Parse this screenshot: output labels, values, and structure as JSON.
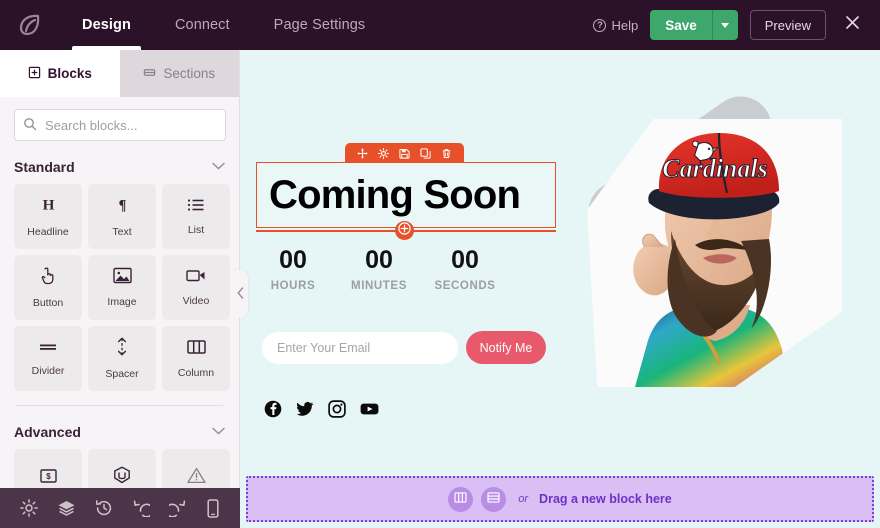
{
  "header": {
    "logo_icon": "leaf-logo-icon",
    "nav": [
      {
        "label": "Design",
        "active": true
      },
      {
        "label": "Connect",
        "active": false
      },
      {
        "label": "Page Settings",
        "active": false
      }
    ],
    "help_label": "Help",
    "save_label": "Save",
    "save_caret_icon": "chevron-down-icon",
    "preview_label": "Preview",
    "close_icon": "close-icon",
    "save_color": "#3da76c",
    "bar_color": "#2c1228"
  },
  "sidebar": {
    "tabs": [
      {
        "label": "Blocks",
        "icon": "blocks-icon",
        "active": true
      },
      {
        "label": "Sections",
        "icon": "sections-icon",
        "active": false
      }
    ],
    "search": {
      "placeholder": "Search blocks...",
      "value": "",
      "icon": "search-icon"
    },
    "sections": [
      {
        "title": "Standard",
        "chevron_icon": "chevron-down-icon",
        "blocks": [
          {
            "label": "Headline",
            "icon": "headline-icon"
          },
          {
            "label": "Text",
            "icon": "text-paragraph-icon"
          },
          {
            "label": "List",
            "icon": "list-icon"
          },
          {
            "label": "Button",
            "icon": "button-click-icon"
          },
          {
            "label": "Image",
            "icon": "image-icon"
          },
          {
            "label": "Video",
            "icon": "video-icon"
          },
          {
            "label": "Divider",
            "icon": "divider-icon"
          },
          {
            "label": "Spacer",
            "icon": "spacer-icon"
          },
          {
            "label": "Column",
            "icon": "column-icon"
          }
        ]
      },
      {
        "title": "Advanced",
        "chevron_icon": "chevron-down-icon",
        "blocks": [
          {
            "label": "",
            "icon": "pricing-icon"
          },
          {
            "label": "",
            "icon": "badge-icon"
          },
          {
            "label": "",
            "icon": "alert-icon"
          }
        ]
      }
    ],
    "collapse_icon": "chevron-left-icon"
  },
  "canvas": {
    "background": "#e6f6f6",
    "selection": {
      "color": "#e8502a",
      "toolbar_icons": [
        "move-icon",
        "gear-icon",
        "save-block-icon",
        "duplicate-icon",
        "trash-icon"
      ],
      "add_icon": "plus-circle-icon"
    },
    "hero_title": "Coming Soon",
    "countdown": [
      {
        "value": "00",
        "label": "HOURS"
      },
      {
        "value": "00",
        "label": "MINUTES"
      },
      {
        "value": "00",
        "label": "SECONDS"
      }
    ],
    "form": {
      "email_placeholder": "Enter Your Email",
      "email_value": "",
      "notify_label": "Notify Me",
      "notify_color": "#e8596b"
    },
    "socials": [
      {
        "name": "facebook-icon"
      },
      {
        "name": "twitter-icon"
      },
      {
        "name": "instagram-icon"
      },
      {
        "name": "youtube-icon"
      }
    ],
    "photo": {
      "cap_text": "Cardinals",
      "alt": "bearded-man-with-red-cap"
    },
    "dropzone": {
      "column_icon": "columns-icon",
      "section_icon": "rows-icon",
      "or_label": "or",
      "text": "Drag a new block here",
      "color": "#7c3fd6"
    }
  },
  "bottombar": {
    "icons": [
      {
        "name": "gear-icon"
      },
      {
        "name": "layers-icon"
      },
      {
        "name": "history-icon"
      },
      {
        "name": "undo-icon"
      },
      {
        "name": "redo-icon"
      },
      {
        "name": "mobile-preview-icon"
      }
    ],
    "color": "#4d3549"
  }
}
